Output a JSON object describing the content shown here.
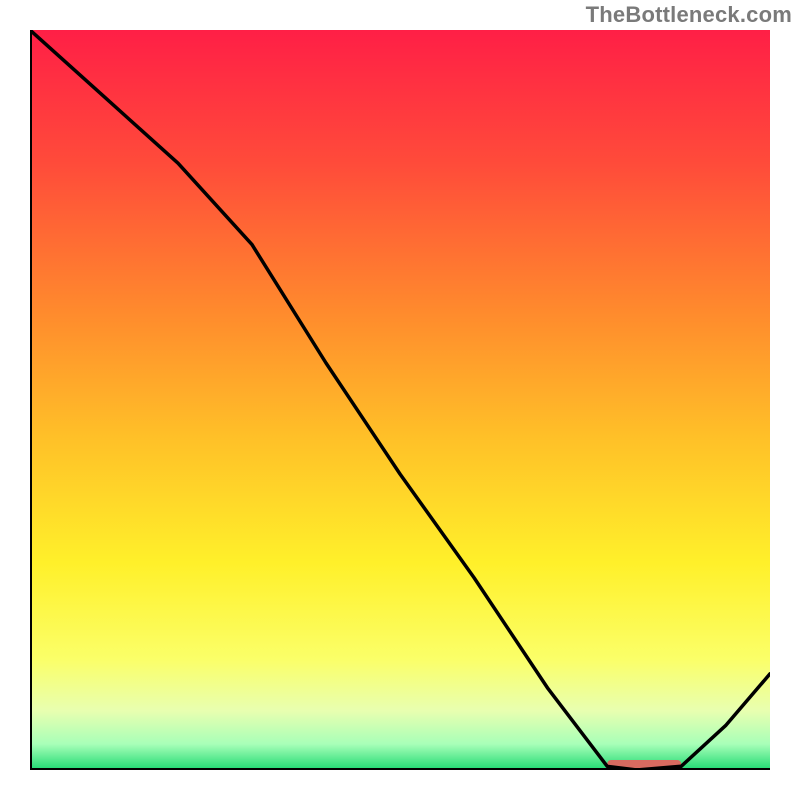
{
  "attribution": "TheBottleneck.com",
  "chart_data": {
    "type": "line",
    "title": "",
    "xlabel": "",
    "ylabel": "",
    "xlim": [
      0,
      100
    ],
    "ylim": [
      0,
      100
    ],
    "grid": false,
    "legend": false,
    "series": [
      {
        "name": "curve",
        "color": "#000000",
        "x": [
          0,
          10,
          20,
          30,
          40,
          50,
          60,
          70,
          78,
          82,
          88,
          94,
          100
        ],
        "y": [
          100,
          91,
          82,
          71,
          55,
          40,
          26,
          11,
          0.5,
          0,
          0.5,
          6,
          13
        ]
      }
    ],
    "highlight_band": {
      "color": "#d86a60",
      "x_start": 78,
      "x_end": 88,
      "y": 0
    },
    "gradient_stops": [
      {
        "offset": 0.0,
        "color": "#ff1f46"
      },
      {
        "offset": 0.18,
        "color": "#ff4b3a"
      },
      {
        "offset": 0.38,
        "color": "#ff8a2d"
      },
      {
        "offset": 0.55,
        "color": "#ffc028"
      },
      {
        "offset": 0.72,
        "color": "#fff02a"
      },
      {
        "offset": 0.85,
        "color": "#fbff68"
      },
      {
        "offset": 0.92,
        "color": "#e8ffb0"
      },
      {
        "offset": 0.965,
        "color": "#a8ffb8"
      },
      {
        "offset": 1.0,
        "color": "#1fd972"
      }
    ],
    "axes": {
      "color": "#000000",
      "width": 4
    }
  }
}
